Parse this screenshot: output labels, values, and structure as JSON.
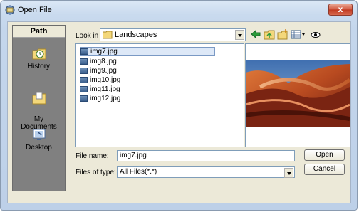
{
  "window": {
    "title": "Open File",
    "close_label": "x"
  },
  "sidebar": {
    "header": "Path",
    "items": [
      {
        "label": "History",
        "icon": "history-icon"
      },
      {
        "label": "My\nDocuments",
        "icon": "my-documents-icon"
      },
      {
        "label": "Desktop",
        "icon": "desktop-icon"
      }
    ]
  },
  "toolbar": {
    "look_in_label": "Look in",
    "look_in_value": "Landscapes",
    "icons": [
      "back-arrow-icon",
      "up-folder-icon",
      "new-folder-icon",
      "view-menu-icon",
      "preview-toggle-icon"
    ]
  },
  "files": [
    {
      "name": "img7.jpg",
      "selected": true
    },
    {
      "name": "img8.jpg",
      "selected": false
    },
    {
      "name": "img9.jpg",
      "selected": false
    },
    {
      "name": "img10.jpg",
      "selected": false
    },
    {
      "name": "img11.jpg",
      "selected": false
    },
    {
      "name": "img12.jpg",
      "selected": false
    }
  ],
  "footer": {
    "file_name_label": "File name:",
    "file_name_value": "img7.jpg",
    "files_of_type_label": "Files of type:",
    "files_of_type_value": "All Files(*.*)",
    "open_label": "Open",
    "cancel_label": "Cancel"
  }
}
